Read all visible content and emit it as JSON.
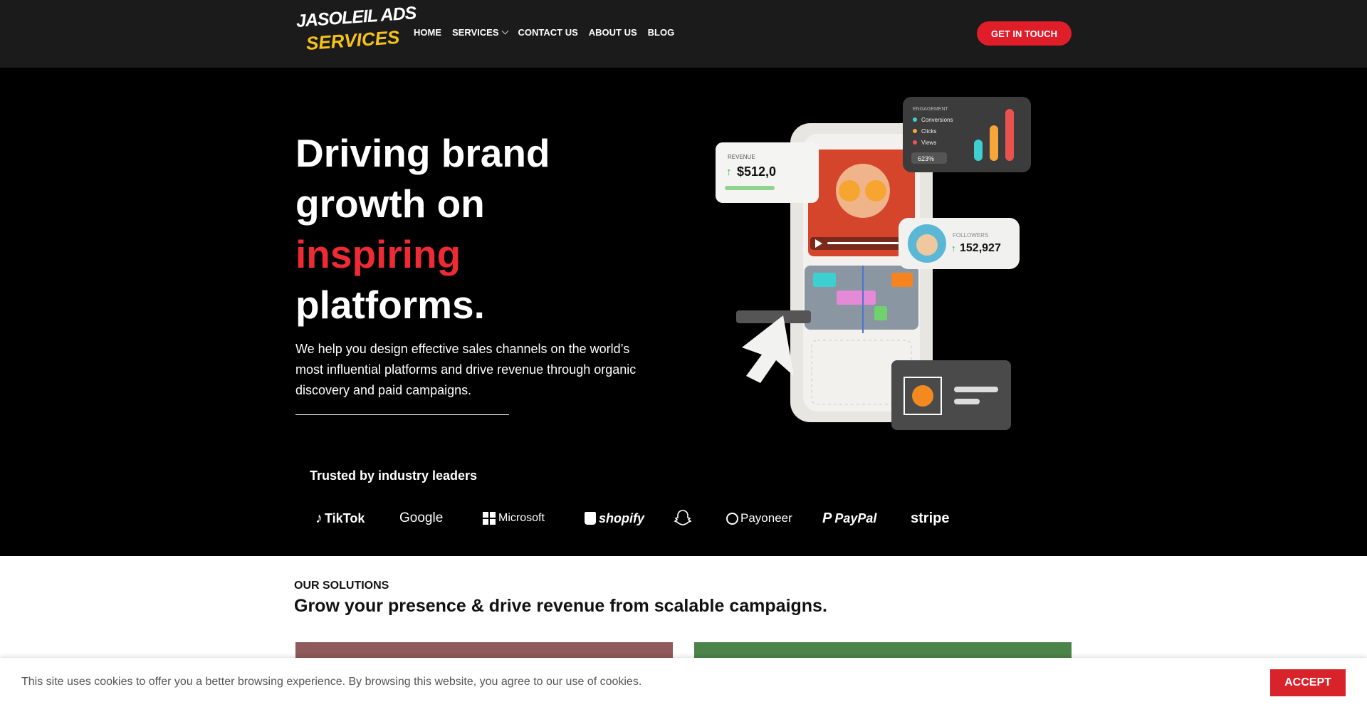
{
  "header": {
    "logo_line1": "JASOLEIL ADS",
    "logo_line2": "SERVICES",
    "menu": [
      {
        "label": "HOME"
      },
      {
        "label": "SERVICES"
      },
      {
        "label": "CONTACT US"
      },
      {
        "label": "ABOUT US"
      },
      {
        "label": "BLOG"
      }
    ],
    "cta_label": "GET IN TOUCH"
  },
  "hero": {
    "title_line1": "Driving brand",
    "title_line2": "growth on",
    "title_highlight": "inspiring",
    "title_line4": "platforms.",
    "description": "We help you design effective sales channels on the world’s most influential platforms and drive revenue through organic discovery and paid campaigns.",
    "trusted_label": "Trusted by industry leaders",
    "brands": [
      "TikTok",
      "Google",
      "Microsoft",
      "shopify",
      "Payoneer",
      "PayPal",
      "stripe"
    ]
  },
  "illustration": {
    "revenue_label": "REVENUE",
    "revenue_value": "$512,0",
    "engagement_label": "ENGAGEMENT",
    "engagement_items": [
      "Conversions",
      "Clicks",
      "Views"
    ],
    "engagement_change": "623%",
    "followers_label": "FOLLOWERS",
    "followers_value": "152,927"
  },
  "solutions": {
    "label": "OUR SOLUTIONS",
    "title": "Grow your presence & drive revenue from scalable campaigns."
  },
  "cookie": {
    "text": "This site uses cookies to offer you a better browsing experience. By browsing this website, you agree to our use of cookies.",
    "accept_label": "ACCEPT"
  },
  "colors": {
    "accent": "#e01e2a",
    "nav_bg": "#1b1b1b",
    "hero_bg": "#000000",
    "logo_yellow": "#f6c21a"
  }
}
